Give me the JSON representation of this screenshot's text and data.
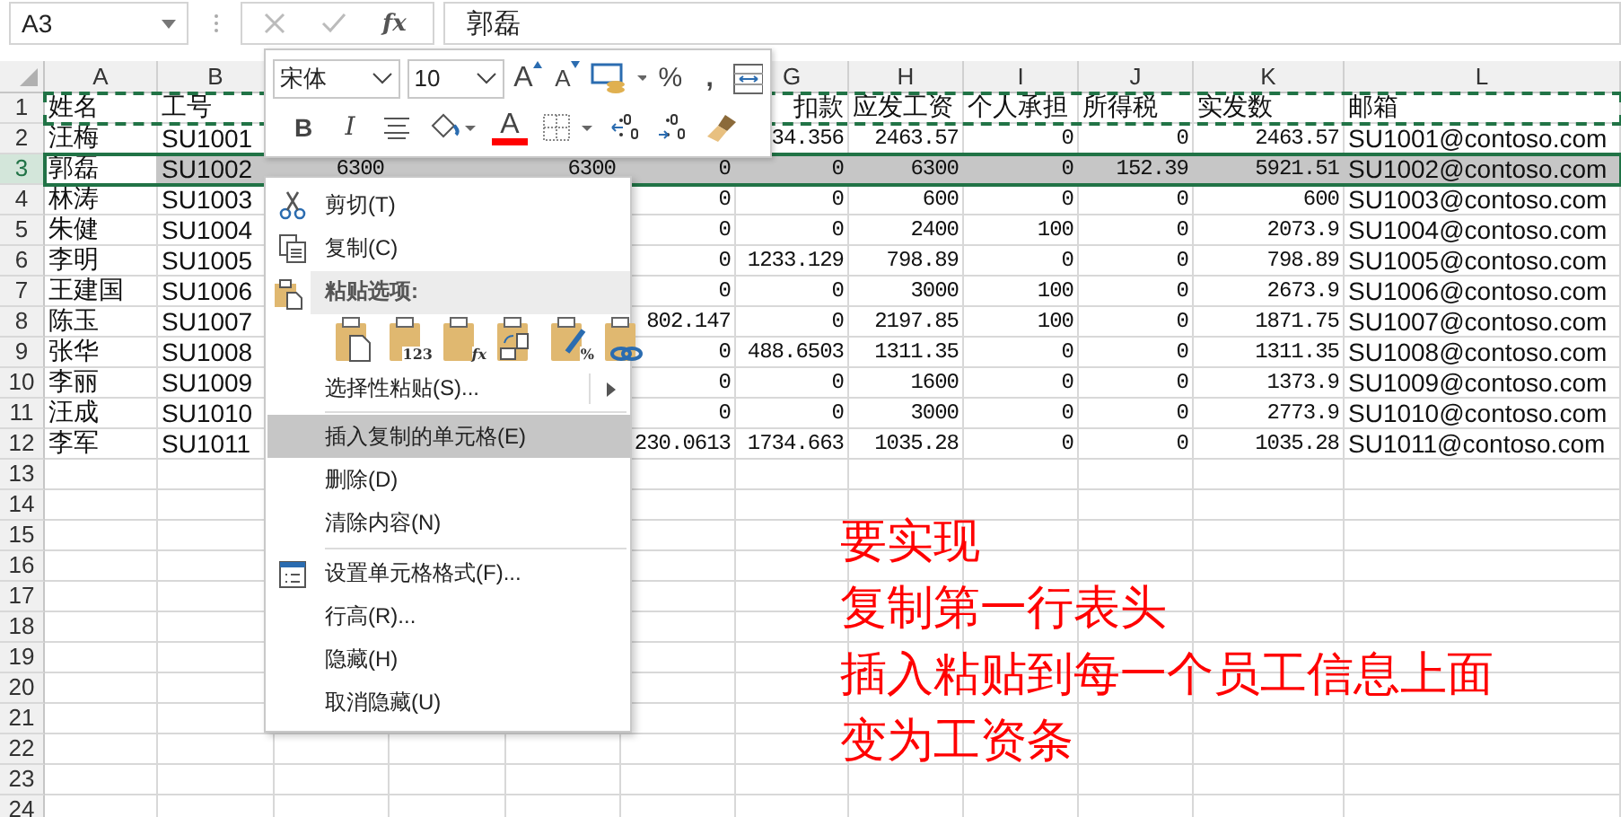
{
  "name_box": {
    "value": "A3"
  },
  "formula_bar": {
    "function_label": "fx",
    "value": "郭磊"
  },
  "columns": [
    "A",
    "B",
    null,
    null,
    null,
    null,
    "G",
    "H",
    "I",
    "J",
    "K",
    "L"
  ],
  "rows": [
    {
      "header": "1",
      "selected": false,
      "copied": true,
      "cells": [
        "姓名",
        "工号",
        null,
        null,
        null,
        null,
        {
          "text": "扣款",
          "partial": true
        },
        "应发工资",
        "个人承担",
        "所得税",
        "实发数",
        "邮箱"
      ]
    },
    {
      "header": "2",
      "selected": false,
      "copied": false,
      "cells": [
        "汪梅",
        "SU1001",
        null,
        null,
        null,
        null,
        "34.356",
        "2463.57",
        "0",
        "0",
        "2463.57",
        "SU1001@contoso.com"
      ]
    },
    {
      "header": "3",
      "selected": true,
      "copied": false,
      "cells": [
        "郭磊",
        "SU1002",
        "6300",
        null,
        "6300",
        "0",
        "0",
        "6300",
        "0",
        "152.39",
        "5921.51",
        "SU1002@contoso.com"
      ]
    },
    {
      "header": "4",
      "selected": false,
      "copied": false,
      "cells": [
        "林涛",
        "SU1003",
        null,
        null,
        null,
        "0",
        "0",
        "600",
        "0",
        "0",
        "600",
        "SU1003@contoso.com"
      ]
    },
    {
      "header": "5",
      "selected": false,
      "copied": false,
      "cells": [
        "朱健",
        "SU1004",
        null,
        null,
        null,
        "0",
        "0",
        "2400",
        "100",
        "0",
        "2073.9",
        "SU1004@contoso.com"
      ]
    },
    {
      "header": "6",
      "selected": false,
      "copied": false,
      "cells": [
        "李明",
        "SU1005",
        null,
        null,
        null,
        "0",
        "1233.129",
        "798.89",
        "0",
        "0",
        "798.89",
        "SU1005@contoso.com"
      ]
    },
    {
      "header": "7",
      "selected": false,
      "copied": false,
      "cells": [
        "王建国",
        "SU1006",
        null,
        null,
        null,
        "0",
        "0",
        "3000",
        "100",
        "0",
        "2673.9",
        "SU1006@contoso.com"
      ]
    },
    {
      "header": "8",
      "selected": false,
      "copied": false,
      "cells": [
        "陈玉",
        "SU1007",
        null,
        null,
        null,
        "802.147",
        "0",
        "2197.85",
        "100",
        "0",
        "1871.75",
        "SU1007@contoso.com"
      ]
    },
    {
      "header": "9",
      "selected": false,
      "copied": false,
      "cells": [
        "张华",
        "SU1008",
        null,
        null,
        null,
        "0",
        "488.6503",
        "1311.35",
        "0",
        "0",
        "1311.35",
        "SU1008@contoso.com"
      ]
    },
    {
      "header": "10",
      "selected": false,
      "copied": false,
      "cells": [
        "李丽",
        "SU1009",
        null,
        null,
        null,
        "0",
        "0",
        "1600",
        "0",
        "0",
        "1373.9",
        "SU1009@contoso.com"
      ]
    },
    {
      "header": "11",
      "selected": false,
      "copied": false,
      "cells": [
        "汪成",
        "SU1010",
        null,
        null,
        null,
        "0",
        "0",
        "3000",
        "0",
        "0",
        "2773.9",
        "SU1010@contoso.com"
      ]
    },
    {
      "header": "12",
      "selected": false,
      "copied": false,
      "cells": [
        "李军",
        "SU1011",
        null,
        null,
        null,
        "230.0613",
        "1734.663",
        "1035.28",
        "0",
        "0",
        "1035.28",
        "SU1011@contoso.com"
      ]
    },
    {
      "header": "13",
      "selected": false,
      "copied": false
    },
    {
      "header": "14",
      "selected": false,
      "copied": false
    },
    {
      "header": "15",
      "selected": false,
      "copied": false
    },
    {
      "header": "16",
      "selected": false,
      "copied": false
    },
    {
      "header": "17",
      "selected": false,
      "copied": false
    },
    {
      "header": "18",
      "selected": false,
      "copied": false
    },
    {
      "header": "19",
      "selected": false,
      "copied": false
    },
    {
      "header": "20",
      "selected": false,
      "copied": false
    },
    {
      "header": "21",
      "selected": false,
      "copied": false
    },
    {
      "header": "22",
      "selected": false,
      "copied": false
    },
    {
      "header": "23",
      "selected": false,
      "copied": false
    },
    {
      "header": "24",
      "selected": false,
      "copied": false
    }
  ],
  "mini_toolbar": {
    "font": "宋体",
    "size": "10",
    "top_buttons": [
      {
        "kind": "grow",
        "text": "A"
      },
      {
        "kind": "shrink",
        "text": "A"
      },
      {
        "kind": "accounting"
      },
      {
        "kind": "percent",
        "text": "%"
      },
      {
        "kind": "comma",
        "text": ","
      },
      {
        "kind": "merge"
      }
    ],
    "bottom_buttons": [
      {
        "kind": "bold",
        "text": "B"
      },
      {
        "kind": "italic",
        "text": "I"
      },
      {
        "kind": "center"
      },
      {
        "kind": "fill"
      },
      {
        "kind": "font-color",
        "text": "A"
      },
      {
        "kind": "borders"
      },
      {
        "kind": "more-decimals"
      },
      {
        "kind": "fewer-decimals"
      },
      {
        "kind": "painter"
      }
    ]
  },
  "context_menu": {
    "items": [
      {
        "kind": "cut",
        "label": "剪切(T)",
        "selected": false
      },
      {
        "kind": "copy",
        "label": "复制(C)",
        "selected": false
      },
      {
        "kind": "paste-header",
        "label": "粘贴选项:",
        "selected": false
      },
      {
        "kind": "paste-options",
        "options": [
          {
            "kind": "paste"
          },
          {
            "kind": "values",
            "text": "123"
          },
          {
            "kind": "formulas",
            "text": "fx"
          },
          {
            "kind": "transpose"
          },
          {
            "kind": "formatting",
            "text": "%"
          },
          {
            "kind": "link"
          }
        ]
      },
      {
        "kind": "submenu",
        "label": "选择性粘贴(S)...",
        "selected": false
      },
      {
        "kind": "separator"
      },
      {
        "kind": "plain",
        "label": "插入复制的单元格(E)",
        "selected": true
      },
      {
        "kind": "plain",
        "label": "删除(D)",
        "selected": false
      },
      {
        "kind": "plain",
        "label": "清除内容(N)",
        "selected": false
      },
      {
        "kind": "separator"
      },
      {
        "kind": "format",
        "label": "设置单元格格式(F)...",
        "selected": false
      },
      {
        "kind": "plain",
        "label": "行高(R)...",
        "selected": false
      },
      {
        "kind": "plain",
        "label": "隐藏(H)",
        "selected": false
      },
      {
        "kind": "plain",
        "label": "取消隐藏(U)",
        "selected": false
      }
    ]
  },
  "annotation": [
    "要实现",
    "复制第一行表头",
    "插入粘贴到每一个员工信息上面",
    "变为工资条"
  ]
}
